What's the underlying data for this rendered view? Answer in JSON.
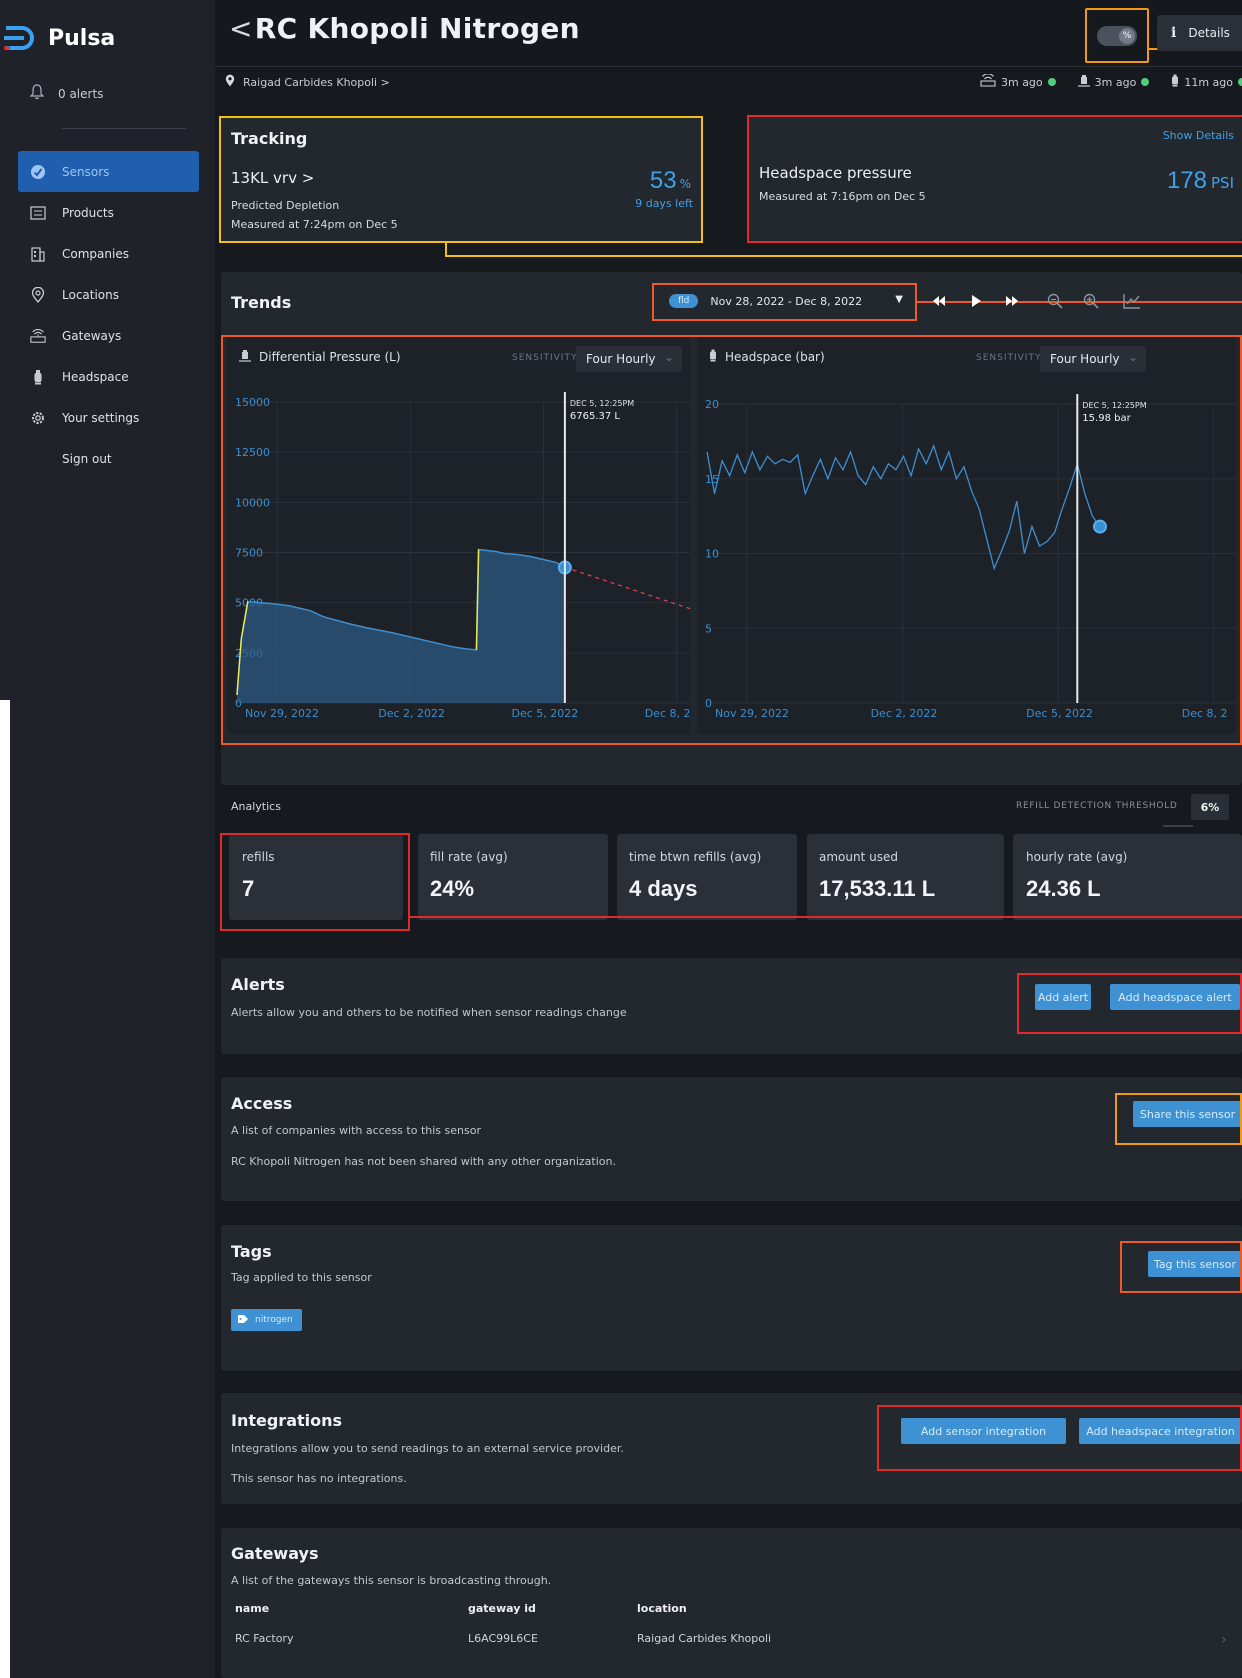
{
  "brand": {
    "name": "Pulsa"
  },
  "sidebar": {
    "alerts_label": "0 alerts",
    "items": [
      {
        "label": "Sensors",
        "icon": "sensor-icon",
        "active": true
      },
      {
        "label": "Products",
        "icon": "products-icon"
      },
      {
        "label": "Companies",
        "icon": "building-icon"
      },
      {
        "label": "Locations",
        "icon": "location-pin-icon"
      },
      {
        "label": "Gateways",
        "icon": "gateway-icon"
      },
      {
        "label": "Headspace",
        "icon": "headspace-icon"
      },
      {
        "label": "Your settings",
        "icon": "gear-icon"
      },
      {
        "label": "Sign out"
      }
    ]
  },
  "header": {
    "back": "<",
    "title": "RC Khopoli Nitrogen",
    "toggle_label": "%",
    "details_icon": "i",
    "details_label": "Details",
    "breadcrumb": "Raigad Carbides Khopoli >",
    "readings": [
      {
        "icon": "gateway-icon",
        "text": "3m ago"
      },
      {
        "icon": "tank-icon",
        "text": "3m ago"
      },
      {
        "icon": "headspace-icon",
        "text": "11m ago"
      }
    ]
  },
  "tracking": {
    "title": "Tracking",
    "product": "13KL vrv >",
    "percent": "53",
    "percent_unit": "%",
    "days_left": "9 days left",
    "predicted": "Predicted Depletion",
    "measured": "Measured at 7:24pm on Dec 5"
  },
  "headspace": {
    "show_details": "Show Details",
    "title": "Headspace pressure",
    "measured": "Measured at 7:16pm on Dec 5",
    "value": "178",
    "unit": "PSI"
  },
  "trends": {
    "title": "Trends",
    "range_badge": "fld",
    "range": "Nov 28, 2022 - Dec 8, 2022",
    "sensitivity_label": "SENSITIVITY",
    "sensitivity_value": "Four Hourly"
  },
  "chart_data": [
    {
      "type": "area",
      "title": "Differential Pressure  (L)",
      "ylim": [
        0,
        15000
      ],
      "y_ticks": [
        "15000",
        "12500",
        "10000",
        "7500",
        "5000",
        "2500",
        "0"
      ],
      "x_ticks": [
        "Nov 29, 2022",
        "Dec 2, 2022",
        "Dec 5, 2022",
        "Dec 8, 2"
      ],
      "x_domain": [
        0,
        10.5
      ],
      "series": [
        {
          "x": [
            0,
            0.1,
            0.25,
            0.8,
            1.2,
            1.7,
            2.0,
            2.6,
            3.0,
            3.6,
            4.0,
            4.5,
            5.0,
            5.3,
            5.55,
            5.6,
            6.0,
            6.2,
            6.5,
            6.8,
            7.1,
            7.4,
            7.6
          ],
          "y": [
            400,
            3200,
            5050,
            4950,
            4850,
            4600,
            4300,
            3950,
            3750,
            3500,
            3300,
            3050,
            2800,
            2700,
            2650,
            7650,
            7550,
            7450,
            7400,
            7300,
            7150,
            7000,
            6750
          ]
        }
      ],
      "forecast": {
        "x": [
          7.6,
          10.5
        ],
        "y": [
          6765.37,
          4700
        ]
      },
      "cursor": {
        "x": 7.6,
        "date": "DEC 5, 12:25PM",
        "value": "6765.37 L"
      }
    },
    {
      "type": "line",
      "title": "Headspace  (bar)",
      "ylim": [
        0,
        20
      ],
      "y_ticks": [
        "20",
        "15",
        "10",
        "5",
        "0"
      ],
      "x_ticks": [
        "Nov 29, 2022",
        "Dec 2, 2022",
        "Dec 5, 2022",
        "Dec 8, 2"
      ],
      "x_domain": [
        0,
        10.5
      ],
      "series": [
        {
          "x": [
            0,
            0.15,
            0.3,
            0.45,
            0.6,
            0.75,
            0.9,
            1.05,
            1.2,
            1.35,
            1.5,
            1.65,
            1.8,
            1.95,
            2.1,
            2.25,
            2.4,
            2.55,
            2.7,
            2.85,
            3.0,
            3.15,
            3.3,
            3.45,
            3.6,
            3.75,
            3.9,
            4.05,
            4.2,
            4.35,
            4.5,
            4.65,
            4.8,
            4.95,
            5.1,
            5.25,
            5.4,
            5.55,
            5.7,
            5.85,
            6.0,
            6.15,
            6.3,
            6.45,
            6.6,
            6.75,
            6.9,
            7.05,
            7.2,
            7.35,
            7.5,
            7.65,
            7.8
          ],
          "y": [
            16.8,
            14.0,
            16.2,
            15.2,
            16.6,
            15.4,
            16.8,
            15.6,
            16.5,
            16.0,
            16.3,
            16.1,
            16.6,
            14.0,
            15.2,
            16.3,
            15.0,
            16.4,
            15.6,
            16.8,
            15.2,
            14.6,
            15.8,
            15.0,
            16.0,
            15.6,
            16.5,
            15.2,
            17.0,
            16.0,
            17.2,
            15.6,
            16.8,
            15.0,
            15.8,
            14.2,
            13.0,
            11.0,
            9.0,
            10.2,
            11.5,
            13.5,
            10.0,
            11.8,
            10.5,
            10.8,
            11.4,
            13.0,
            14.4,
            16.0,
            14.0,
            12.5,
            11.8
          ],
          "point": {
            "x": 7.8,
            "y": 11.8
          }
        }
      ],
      "cursor": {
        "x": 7.35,
        "date": "DEC 5, 12:25PM",
        "value": "15.98 bar"
      }
    }
  ],
  "analytics": {
    "title": "Analytics",
    "threshold_label": "REFILL DETECTION THRESHOLD",
    "threshold_value": "6%",
    "stats": [
      {
        "label": "refills",
        "value": "7"
      },
      {
        "label": "fill rate (avg)",
        "value": "24%"
      },
      {
        "label": "time btwn refills (avg)",
        "value": "4 days"
      },
      {
        "label": "amount used",
        "value": "17,533.11 L"
      },
      {
        "label": "hourly rate (avg)",
        "value": "24.36 L"
      }
    ]
  },
  "alerts": {
    "title": "Alerts",
    "desc": "Alerts allow you and others to be notified when sensor readings change",
    "add_alert": "Add alert",
    "add_headspace_alert": "Add headspace alert"
  },
  "access": {
    "title": "Access",
    "desc": "A list of companies with access to this sensor",
    "note": "RC Khopoli Nitrogen has not been shared with any other organization.",
    "share": "Share this sensor"
  },
  "tags": {
    "title": "Tags",
    "desc": "Tag applied to this sensor",
    "tag": "nitrogen",
    "tag_button": "Tag this sensor"
  },
  "integrations": {
    "title": "Integrations",
    "desc": "Integrations allow you to send readings to an external service provider.",
    "note": "This sensor has no integrations.",
    "add_sensor": "Add sensor integration",
    "add_headspace": "Add headspace integration"
  },
  "gateways": {
    "title": "Gateways",
    "desc": "A list of the gateways this sensor is broadcasting through.",
    "columns": [
      "name",
      "gateway id",
      "location"
    ],
    "rows": [
      {
        "name": "RC Factory",
        "id": "L6AC99L6CE",
        "location": "Raigad Carbides Khopoli"
      }
    ]
  },
  "colors": {
    "accent": "#3fa2e6",
    "annotation_yellow": "#f2bf18",
    "annotation_red": "#e02b2b",
    "annotation_orange": "#f29a18",
    "online": "#4cd17a"
  }
}
